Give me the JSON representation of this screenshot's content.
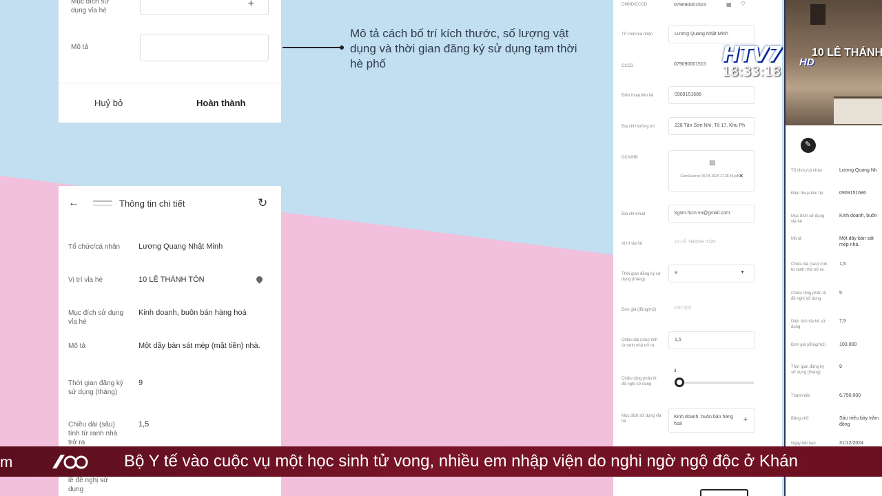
{
  "form_card": {
    "purpose_label": "Mục đích sử dụng vỉa hè",
    "description_label": "Mô tả",
    "cancel_label": "Huỷ bỏ",
    "complete_label": "Hoàn thành"
  },
  "caption": "Mô tả cách bố trí kích thước, số lượng vật dụng và thời gian đăng ký sử dụng tạm thời hè phố",
  "detail": {
    "title": "Thông tin chi tiết",
    "rows": [
      {
        "label": "Tổ chức/cá nhân",
        "value": "Lương Quang Nhật Minh"
      },
      {
        "label": "Vị trí vỉa hè",
        "value": "10 LÊ THÁNH TÔN"
      },
      {
        "label": "Mục đích sử dụng vỉa hè",
        "value": "Kinh doanh, buôn bán hàng hoá"
      },
      {
        "label": "Mô tả",
        "value": "Một dãy bàn sát mép (mặt tiền) nhà."
      },
      {
        "label": "Thời gian đăng ký sử dụng (tháng)",
        "value": "9"
      },
      {
        "label": "Chiều dài (sâu) tính từ ranh nhà trở ra",
        "value": "1,5"
      },
      {
        "label": "Chiều rộng phần lề đề nghị sử dụng",
        "value": ""
      }
    ]
  },
  "right_panel": {
    "rows": [
      {
        "label": "CMND/CCCD",
        "value": "079090001515"
      },
      {
        "label": "Tổ chức/cá nhân",
        "value": "Lương Quang Nhật Minh"
      },
      {
        "label": "CCCD",
        "value": "079090001515"
      },
      {
        "label": "Điện thoại liên hệ",
        "value": "0909151686"
      },
      {
        "label": "Địa chỉ thường trú",
        "value": "228 Tân Sơn Nhì, Tổ 17, Khu Ph"
      },
      {
        "label": "GCN/HĐ",
        "value": "CamScanner 05-04-2024 17.28.46.pdf"
      },
      {
        "label": "Địa chỉ email",
        "value": "kgsm.hcm.vn@gmail.com"
      },
      {
        "label": "Vị trí vỉa hè",
        "value": "10 LÊ THÁNH TÔN"
      },
      {
        "label": "Thời gian đăng ký sử dụng (tháng)",
        "value": "9"
      },
      {
        "label": "Đơn giá (đồng/m2)",
        "value": "100.000"
      },
      {
        "label": "Chiều dài (sâu) tính từ ranh nhà trở ra",
        "value": "1,5"
      },
      {
        "label": "Chiều rộng phần lề đề nghị sử dụng",
        "value": "3"
      },
      {
        "label": "Mục đích sử dụng vỉa hè",
        "value": "Kinh doanh, buôn bán hàng hoá"
      }
    ],
    "slider_fraction": 0.05
  },
  "far_right": {
    "rows": [
      {
        "label": "Tổ chức/cá nhân",
        "value": "Lương Quang Nh"
      },
      {
        "label": "Điện thoại liên hệ",
        "value": "0909151686"
      },
      {
        "label": "Mục đích sử dụng vỉa hè",
        "value": "Kinh doanh, buôn"
      },
      {
        "label": "Mô tả",
        "value": "Một dãy bàn sát mép nhà."
      },
      {
        "label": "Chiều dài (sâu) tính từ ranh nhà trở ra",
        "value": "1,5"
      },
      {
        "label": "Chiều rộng phần lề đề nghị sử dụng",
        "value": "5"
      },
      {
        "label": "Diện tích vỉa hè sử dụng",
        "value": "7,5"
      },
      {
        "label": "Đơn giá (đồng/m2)",
        "value": "100.000"
      },
      {
        "label": "Thời gian đăng ký sử dụng (tháng)",
        "value": "9"
      },
      {
        "label": "Thành tiền",
        "value": "6.750.000"
      },
      {
        "label": "Bằng chữ",
        "value": "Sáu triệu bảy trăm đồng"
      },
      {
        "label": "Ngày hết hạn",
        "value": "31/12/2024"
      }
    ]
  },
  "overlay": {
    "logo": "HTV7",
    "logo_hd": "HD",
    "clock": "18:33:18",
    "street_sign": "10 LÊ THÁNH"
  },
  "ticker": {
    "left_fragment": "m",
    "text": "Bộ Y tế vào cuộc vụ một học sinh tử vong, nhiều em nhập viện do nghi ngờ ngộ độc ở Khán"
  },
  "colors": {
    "sky_blue": "#c2dff1",
    "pink": "#f2bfdc",
    "ticker_bg": "#7a1428",
    "logo_blue": "#0a2aa0"
  }
}
